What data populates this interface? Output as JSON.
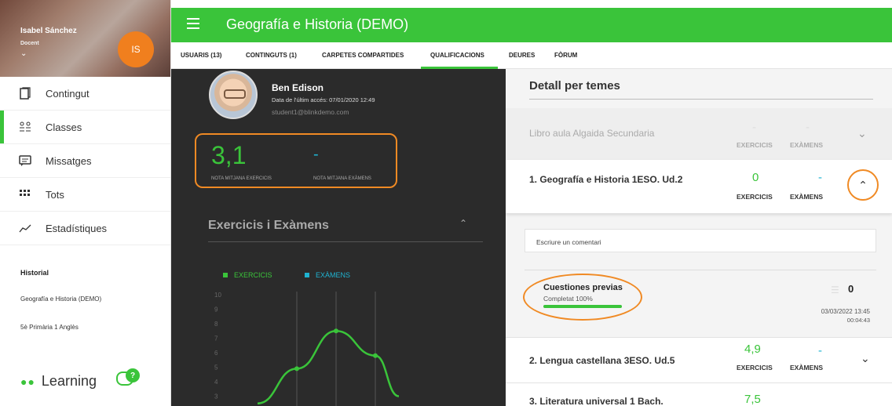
{
  "user": {
    "name": "Isabel Sánchez",
    "role": "Docent",
    "initials": "IS"
  },
  "sidebar": {
    "items": [
      {
        "label": "Contingut",
        "icon": "book-icon"
      },
      {
        "label": "Classes",
        "icon": "people-icon"
      },
      {
        "label": "Missatges",
        "icon": "message-icon"
      },
      {
        "label": "Tots",
        "icon": "grid-icon"
      },
      {
        "label": "Estadístiques",
        "icon": "chart-icon"
      }
    ],
    "history_title": "Historial",
    "history": [
      "Geografía e Historia (DEMO)",
      "5è Primària 1 Anglès"
    ],
    "brand": "Learning",
    "help_badge": "?"
  },
  "header": {
    "title": "Geografía e Historia (DEMO)"
  },
  "tabs": [
    {
      "label": "USUARIS (13)"
    },
    {
      "label": "CONTINGUTS (1)"
    },
    {
      "label": "CARPETES COMPARTIDES"
    },
    {
      "label": "QUALIFICACIONS"
    },
    {
      "label": "DEURES"
    },
    {
      "label": "FÒRUM"
    }
  ],
  "student": {
    "name": "Ben Edison",
    "last_access": "Data de l'últim accés: 07/01/2020 12:49",
    "email": "student1@blinkdemo.com",
    "avg_exercises": "3,1",
    "avg_exams": "-",
    "avg_exercises_label": "NOTA MITJANA EXERCICIS",
    "avg_exams_label": "NOTA MITJANA EXÀMENS"
  },
  "chart_section": {
    "title": "Exercicis i Exàmens"
  },
  "chart_data": {
    "type": "line",
    "ylim": [
      0,
      10
    ],
    "y_ticks": [
      "10",
      "9",
      "8",
      "7",
      "6",
      "5",
      "4",
      "3"
    ],
    "series": [
      {
        "name": "EXERCICIS",
        "color": "#3ac43a",
        "points": [
          [
            0.5,
            2.5
          ],
          [
            1,
            4.9
          ],
          [
            1.5,
            7.5
          ],
          [
            2,
            5.8
          ],
          [
            2.3,
            3
          ]
        ]
      },
      {
        "name": "EXÀMENS",
        "color": "#1fb3d1",
        "points": []
      }
    ]
  },
  "detail": {
    "title": "Detall per temes",
    "col_exercises": "EXERCICIS",
    "col_exams": "EXÀMENS",
    "rows": [
      {
        "title": "Libro aula Algaida Secundaria",
        "exercises": "-",
        "exams": "-"
      },
      {
        "title": "1. Geografía e Historia 1ESO. Ud.2",
        "exercises": "0",
        "exams": "-"
      },
      {
        "title": "2. Lengua castellana 3ESO. Ud.5",
        "exercises": "4,9",
        "exams": "-"
      },
      {
        "title": "3. Literatura universal 1 Bach.",
        "exercises": "7,5",
        "exams": ""
      }
    ],
    "comment_placeholder": "Escriure un comentari",
    "exercise": {
      "name": "Cuestiones previas",
      "status": "Completat 100%",
      "progress": 1.0,
      "messages": "0",
      "date": "03/03/2022 13:45",
      "duration": "00:04:43"
    }
  }
}
